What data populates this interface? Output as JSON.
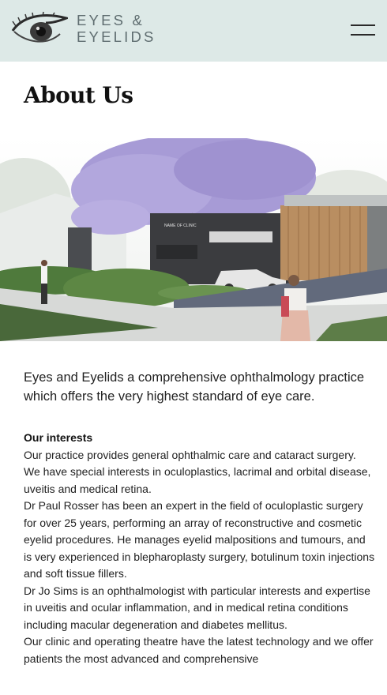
{
  "header": {
    "logo_icon": "eye-logo-icon",
    "brand_line1": "EYES &",
    "brand_line2": "EYELIDS",
    "menu_icon": "hamburger-menu-icon",
    "background": "#dde9e7"
  },
  "page": {
    "title": "About Us",
    "hero_image": {
      "description_icon": "clinic-building-photo",
      "sign_text": "NAME OF CLINIC"
    },
    "intro": "Eyes and Eyelids a comprehensive ophthalmology practice which offers the very highest standard of eye care.",
    "interests_heading": "Our interests",
    "paragraphs": [
      " Our practice provides  general ophthalmic care and cataract surgery.  We have special interests in oculoplastics, lacrimal and orbital disease, uveitis and medical retina.",
      " Dr Paul Rosser has been an expert in the field of oculoplastic surgery for over 25 years, performing an array of reconstructive and cosmetic eyelid procedures.  He manages eyelid malpositions and tumours, and is very experienced in blepharoplasty surgery, botulinum toxin injections and soft tissue fillers.",
      " Dr Jo Sims is an ophthalmologist with particular interests and expertise in uveitis and ocular inflammation, and in medical retina conditions including macular degeneration and diabetes mellitus.",
      " Our clinic and operating theatre have the latest technology and we offer patients the most advanced and comprehensive"
    ]
  }
}
